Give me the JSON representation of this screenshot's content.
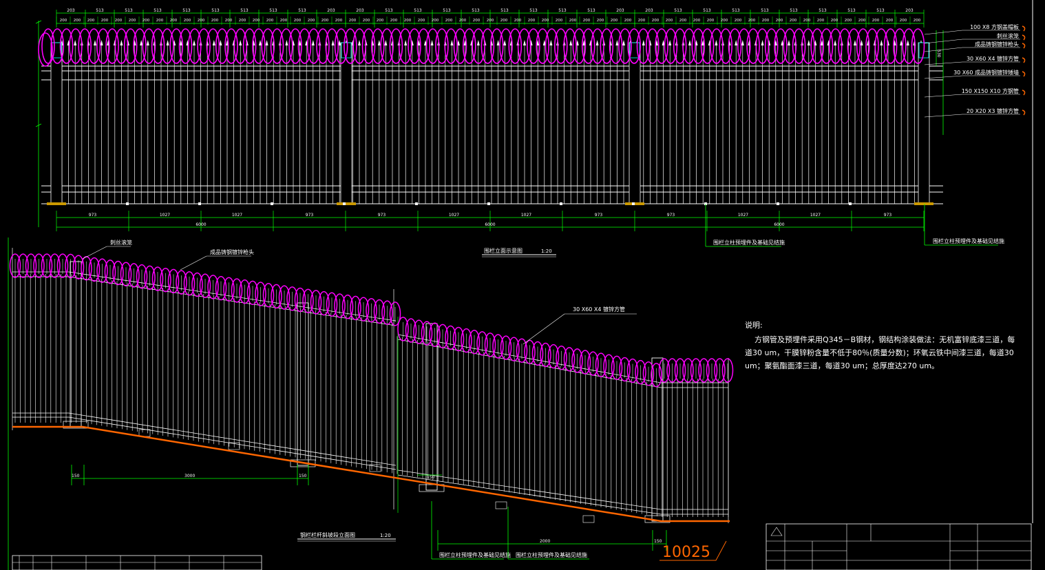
{
  "elevation": {
    "top_dims": [
      "203",
      "513",
      "513",
      "513",
      "513",
      "513",
      "513",
      "513",
      "513",
      "203",
      "203",
      "513",
      "513",
      "513",
      "513",
      "513",
      "513",
      "513",
      "513",
      "203",
      "203",
      "513",
      "513",
      "513",
      "513",
      "513",
      "513",
      "513",
      "513",
      "203"
    ],
    "sub_dim": "200",
    "bottom_dims": [
      "973",
      "1027",
      "1027",
      "973",
      "973",
      "1027",
      "1027",
      "973",
      "973",
      "1027",
      "1027",
      "973"
    ],
    "span_dims": [
      "6000",
      "6000",
      "6000"
    ],
    "side_dim": "530",
    "callouts": [
      "100 X8 方钢盖帽板",
      "刺丝滚笼",
      "成品铸钢镀锌枪头",
      "30 X60 X4 镀锌方管",
      "30 X60 成品铸钢镀锌矮墙",
      "150 X150 X10 方钢管",
      "20 X20 X3 镀锌方管"
    ],
    "foundation_notes": [
      "围栏立柱预埋件及基础见结施",
      "围栏立柱预埋件及基础见结施"
    ],
    "title": "围栏立面示意图",
    "scale": "1:20"
  },
  "slope": {
    "labels": [
      "刺丝滚笼",
      "成品铸钢镀锌枪头",
      "30 X60 X4 镀锌方管"
    ],
    "dims": [
      "150",
      "3000",
      "150",
      "150",
      "2000",
      "150"
    ],
    "foundation_notes": [
      "围栏立柱预埋件及基础见结施",
      "围栏立柱预埋件及基础见结施"
    ],
    "title": "钢栏栏杆斜坡段立面图",
    "scale": "1:20",
    "big_number": "10025"
  },
  "notes": {
    "heading": "说明:",
    "body": "方钢管及预埋件采用Q345－B钢材，钢结构涂装做法：无机富锌底漆三道，每道30 um，干膜锌粉含量不低于80％(质量分数)；环氧云铁中间漆三道，每道30 um；聚氨酯面漆三道，每道30 um；总厚度达270 um。"
  },
  "colors": {
    "background": "#000000",
    "wire": "#ff00ff",
    "dim": "#00ff00",
    "ground": "#ff6600",
    "line": "#ffffff",
    "cyan": "#00ffff"
  }
}
